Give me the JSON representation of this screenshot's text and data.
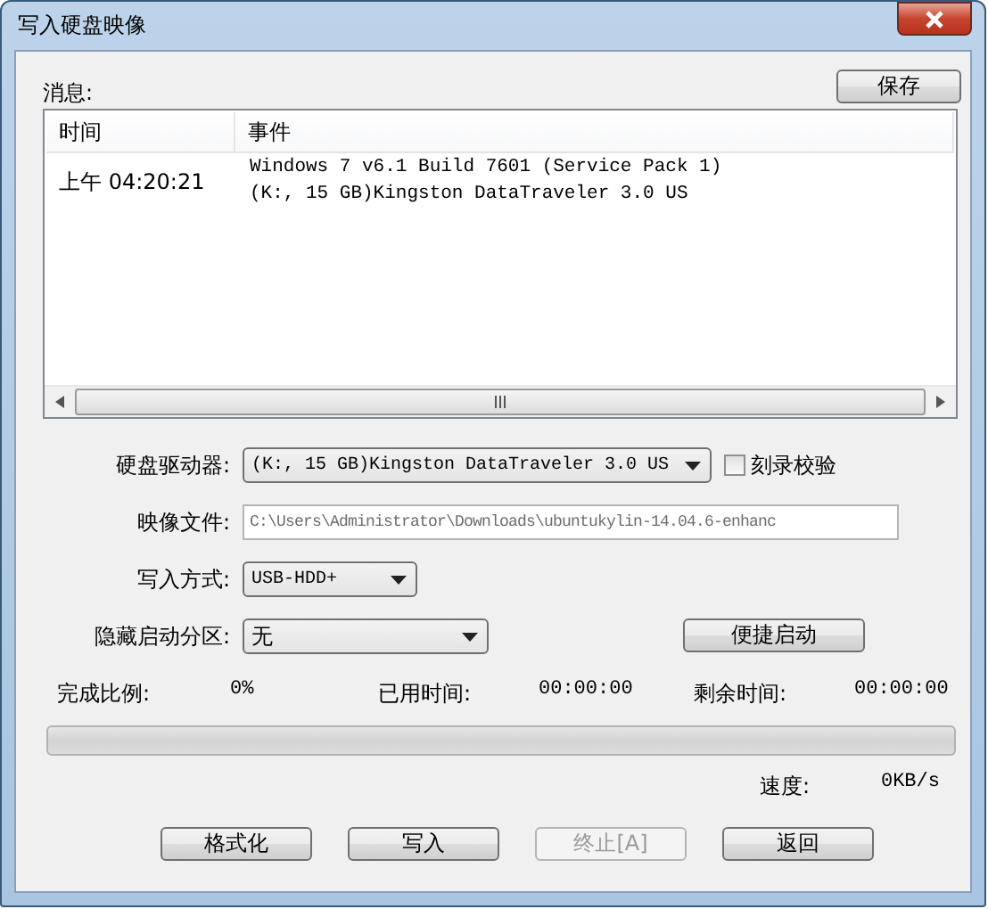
{
  "window": {
    "title": "写入硬盘映像"
  },
  "messages": {
    "label": "消息:",
    "save_button": "保存",
    "columns": [
      "时间",
      "事件"
    ],
    "rows": [
      {
        "time": "上午 04:20:21",
        "event_lines": [
          "Windows 7 v6.1 Build 7601 (Service Pack 1)",
          "(K:, 15 GB)Kingston DataTraveler 3.0 US"
        ]
      }
    ]
  },
  "form": {
    "drive": {
      "label": "硬盘驱动器:",
      "value": "(K:, 15 GB)Kingston DataTraveler 3.0 US"
    },
    "verify": {
      "label": "刻录校验",
      "checked": false
    },
    "image_file": {
      "label": "映像文件:",
      "value": "C:\\Users\\Administrator\\Downloads\\ubuntukylin-14.04.6-enhanc"
    },
    "write_mode": {
      "label": "写入方式:",
      "value": "USB-HDD+"
    },
    "hidden_partition": {
      "label": "隐藏启动分区:",
      "value": "无"
    },
    "quick_boot_button": "便捷启动"
  },
  "progress": {
    "percent_label": "完成比例:",
    "percent": "0%",
    "elapsed_label": "已用时间:",
    "elapsed": "00:00:00",
    "remaining_label": "剩余时间:",
    "remaining": "00:00:00",
    "level": 0,
    "speed_label": "速度:",
    "speed": "0KB/s"
  },
  "buttons": [
    {
      "label": "格式化",
      "disabled": false
    },
    {
      "label": "写入",
      "disabled": false
    },
    {
      "label": "终止[A]",
      "disabled": true
    },
    {
      "label": "返回",
      "disabled": false
    }
  ]
}
